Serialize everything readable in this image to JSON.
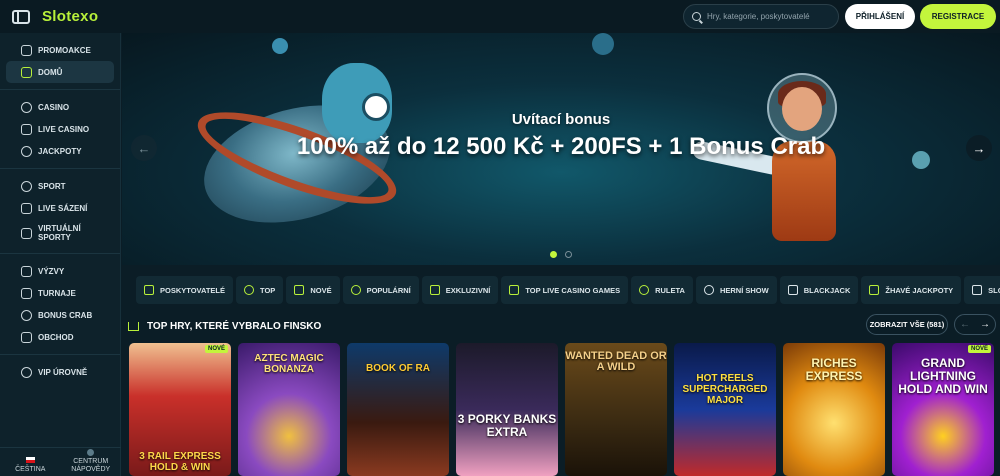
{
  "header": {
    "logo": "Slotexo",
    "search_placeholder": "Hry, kategorie, poskytovatelé",
    "login_label": "PŘIHLÁŠENÍ",
    "register_label": "REGISTRACE"
  },
  "sidebar": {
    "groups": [
      [
        {
          "label": "PROMOAKCE",
          "icon": "gift-icon"
        },
        {
          "label": "DOMŮ",
          "icon": "home-icon",
          "active": true
        }
      ],
      [
        {
          "label": "CASINO",
          "icon": "casino-chip-icon"
        },
        {
          "label": "LIVE CASINO",
          "icon": "live-icon"
        },
        {
          "label": "JACKPOTY",
          "icon": "jackpot-icon"
        }
      ],
      [
        {
          "label": "SPORT",
          "icon": "ball-icon"
        },
        {
          "label": "LIVE SÁZENÍ",
          "icon": "live-bet-icon"
        },
        {
          "label": "VIRTUÁLNÍ SPORTY",
          "icon": "virtual-icon"
        }
      ],
      [
        {
          "label": "VÝZVY",
          "icon": "trophy-icon"
        },
        {
          "label": "TURNAJE",
          "icon": "tournament-icon"
        },
        {
          "label": "BONUS CRAB",
          "icon": "crab-icon"
        },
        {
          "label": "OBCHOD",
          "icon": "shop-icon"
        }
      ],
      [
        {
          "label": "VIP ÚROVNĚ",
          "icon": "vip-icon"
        }
      ]
    ],
    "language": "ČEŠTINA",
    "help": "CENTRUM NÁPOVĚDY"
  },
  "hero": {
    "subtitle": "Uvítací bonus",
    "title": "100% až do 12 500 Kč + 200FS + 1 Bonus Crab",
    "slides_total": 2,
    "active_slide": 1
  },
  "categories": [
    {
      "label": "POSKYTOVATELÉ",
      "icon": "grid-icon"
    },
    {
      "label": "TOP",
      "icon": "top-icon"
    },
    {
      "label": "NOVÉ",
      "icon": "rocket-icon"
    },
    {
      "label": "POPULÁRNÍ",
      "icon": "fire-icon"
    },
    {
      "label": "EXKLUZIVNÍ",
      "icon": "diamond-icon"
    },
    {
      "label": "TOP LIVE CASINO GAMES",
      "icon": "star-icon"
    },
    {
      "label": "RULETA",
      "icon": "roulette-icon"
    },
    {
      "label": "HERNÍ SHOW",
      "icon": "wheel-icon"
    },
    {
      "label": "BLACKJACK",
      "icon": "spade-icon"
    },
    {
      "label": "ŽHAVÉ JACKPOTY",
      "icon": "hot-jackpot-icon"
    },
    {
      "label": "SLOTY",
      "icon": "slot-icon"
    }
  ],
  "section": {
    "title": "TOP HRY, KTERÉ VYBRALO FINSKO",
    "show_all": "ZOBRAZIT VŠE (581)"
  },
  "games": [
    {
      "title": "3 RAIL EXPRESS HOLD & WIN",
      "badge": "NOVÉ"
    },
    {
      "title": "AZTEC MAGIC BONANZA",
      "badge": ""
    },
    {
      "title": "BOOK OF RA",
      "badge": ""
    },
    {
      "title": "3 PORKY BANKS EXTRA",
      "badge": ""
    },
    {
      "title": "WANTED DEAD OR A WILD",
      "badge": ""
    },
    {
      "title": "HOT REELS SUPERCHARGED MAJOR",
      "badge": ""
    },
    {
      "title": "RICHES EXPRESS",
      "badge": ""
    },
    {
      "title": "GRAND LIGHTNING HOLD AND WIN",
      "badge": "NOVÉ"
    }
  ]
}
